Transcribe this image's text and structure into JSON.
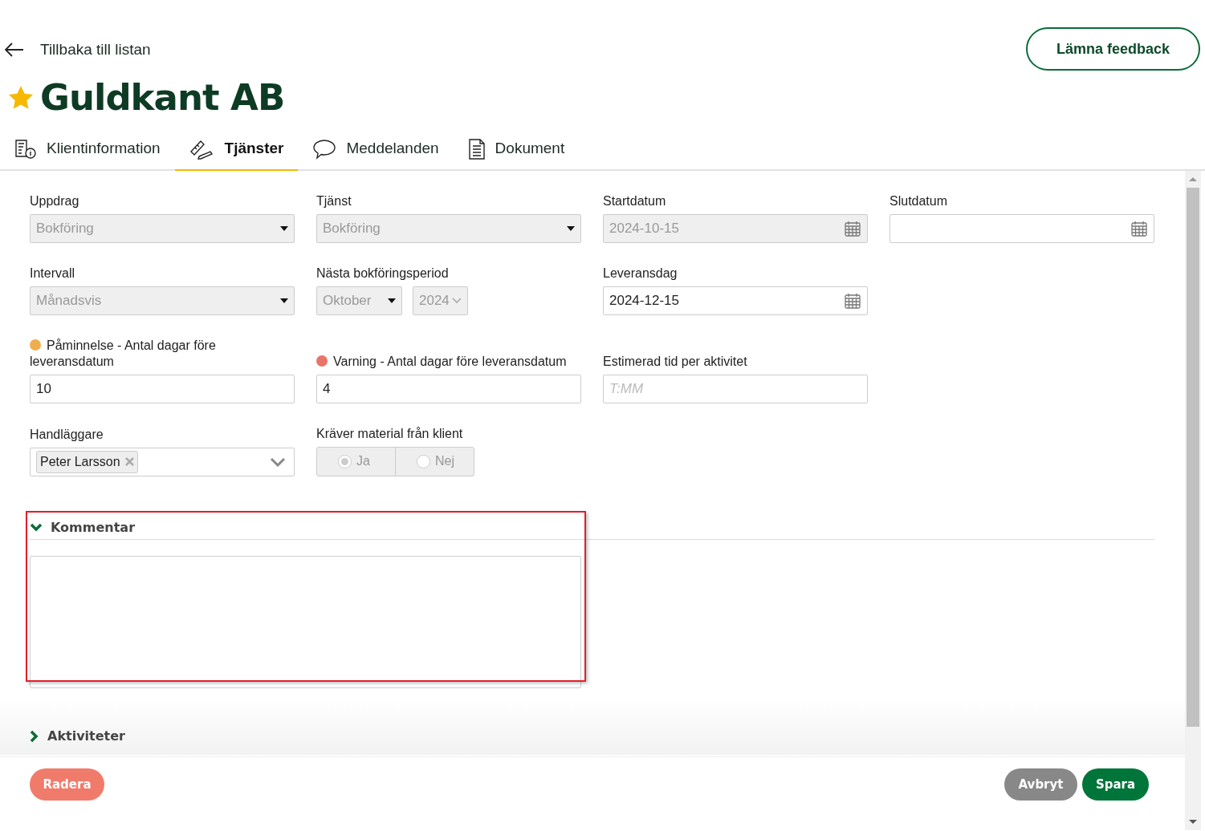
{
  "back_link": "Tillbaka till listan",
  "feedback_button": "Lämna feedback",
  "title": {
    "text": "Guldkant AB",
    "favorite": true
  },
  "tabs": [
    {
      "label": "Klientinformation",
      "selected": false
    },
    {
      "label": "Tjänster",
      "selected": true
    },
    {
      "label": "Meddelanden",
      "selected": false
    },
    {
      "label": "Dokument",
      "selected": false
    }
  ],
  "form_rows": [
    [
      {
        "kind": "select",
        "label": "Uppdrag",
        "value": "Bokföring",
        "disabled": true
      },
      {
        "kind": "select",
        "label": "Tjänst",
        "value": "Bokföring",
        "disabled": true
      },
      {
        "kind": "date",
        "label": "Startdatum",
        "value": "2024-10-15",
        "disabled": true
      },
      {
        "kind": "date",
        "label": "Slutdatum",
        "disabled": false
      }
    ],
    [
      {
        "kind": "select",
        "label": "Intervall",
        "value": "Månadsvis",
        "disabled": true
      },
      {
        "kind": "period",
        "label": "Nästa bokföringsperiod",
        "month": "Oktober",
        "year": "2024",
        "disabled": true
      },
      {
        "kind": "date",
        "label": "Leveransdag",
        "value": "2024-12-15",
        "disabled": false
      }
    ],
    [
      {
        "kind": "input",
        "label": "Påminnelse - Antal dagar före leveransdatum",
        "color": "#f0ad4e",
        "value": "10",
        "disabled": false
      },
      {
        "kind": "input",
        "label": "Varning - Antal dagar före leveransdatum",
        "color": "#e8756a",
        "value": "4",
        "disabled": false
      },
      {
        "kind": "input",
        "label": "Estimerad tid per aktivitet",
        "placeholder": "T:MM",
        "disabled": false
      }
    ],
    [
      {
        "kind": "tags",
        "label": "Handläggare",
        "tags": [
          "Peter Larsson"
        ],
        "disabled": false
      },
      {
        "kind": "radio",
        "label": "Kräver material från klient",
        "disabled": true,
        "options": [
          {
            "label": "Ja",
            "selected": true
          },
          {
            "label": "Nej",
            "selected": false
          }
        ]
      }
    ]
  ],
  "sections": [
    {
      "title": "Kommentar",
      "expanded": true,
      "highlighted": true
    },
    {
      "title": "Aktiviteter",
      "expanded": false,
      "highlighted": false
    }
  ],
  "footer": {
    "delete_button": "Radera",
    "cancel_button": "Avbryt",
    "save_button": "Spara"
  }
}
